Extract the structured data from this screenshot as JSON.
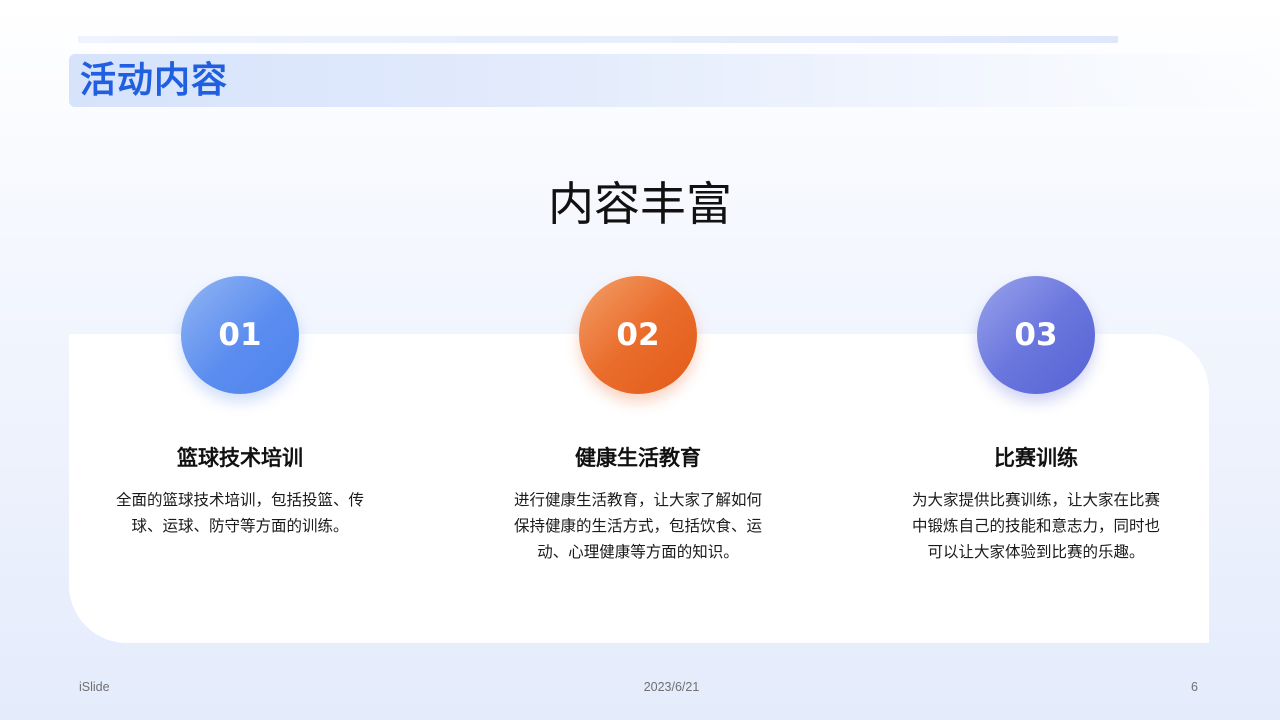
{
  "slide": {
    "section_title": "活动内容",
    "headline": "内容丰富",
    "colors": {
      "title_blue": "#1f5fe0",
      "badge_blue": "#5b8def",
      "badge_orange": "#e8661f",
      "badge_indigo": "#5f6bd8"
    }
  },
  "items": [
    {
      "number": "01",
      "title": "篮球技术培训",
      "description": "全面的篮球技术培训，包括投篮、传球、运球、防守等方面的训练。"
    },
    {
      "number": "02",
      "title": "健康生活教育",
      "description": "进行健康生活教育，让大家了解如何保持健康的生活方式，包括饮食、运动、心理健康等方面的知识。"
    },
    {
      "number": "03",
      "title": "比赛训练",
      "description": "为大家提供比赛训练，让大家在比赛中锻炼自己的技能和意志力，同时也可以让大家体验到比赛的乐趣。"
    }
  ],
  "footer": {
    "brand": "iSlide",
    "date": "2023/6/21",
    "page_number": "6"
  }
}
